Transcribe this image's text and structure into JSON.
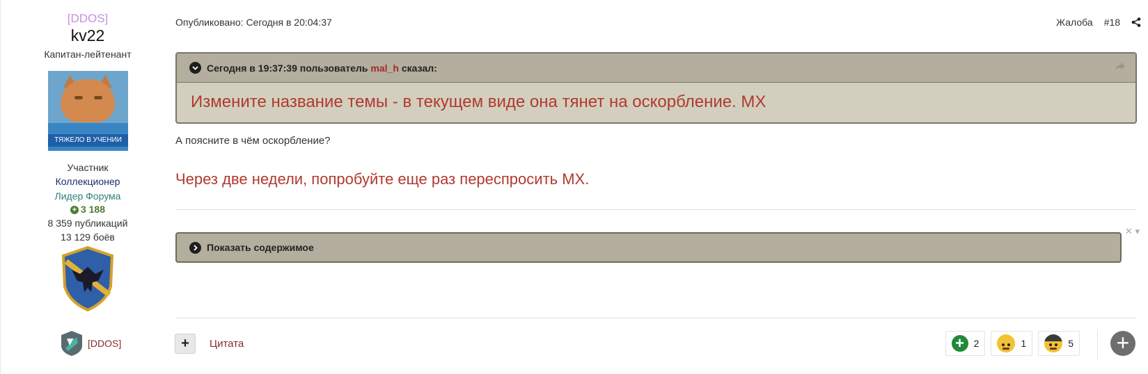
{
  "author": {
    "clan_tag": "[DDOS]",
    "username": "kv22",
    "rank": "Капитан-лейтенант",
    "avatar_caption": "ТЯЖЕЛО В УЧЕНИИ",
    "roles": [
      "Участник",
      "Коллекционер",
      "Лидер Форума"
    ],
    "reputation": "3 188",
    "posts": "8 359 публикаций",
    "battles": "13 129 боёв",
    "clan_row_label": "[DDOS]"
  },
  "post": {
    "published": "Опубликовано: Сегодня в 20:04:37",
    "report_label": "Жалоба",
    "post_number": "#18",
    "quote": {
      "prefix": "Сегодня в 19:37:39 пользователь",
      "user": "mal_h",
      "suffix": "сказал:",
      "text": "Измените название темы - в текущем виде она тянет на оскорбление. МХ"
    },
    "text": "А поясните в чём оскорбление?",
    "moderator_note": "Через две недели, попробуйте еще раз переспросить МХ.",
    "spoiler_label": "Показать содержимое"
  },
  "footer": {
    "multiquote_symbol": "+",
    "quote_label": "Цитата",
    "reactions": [
      {
        "icon": "plus-icon",
        "count": "2"
      },
      {
        "icon": "smiley-icon",
        "count": "1"
      },
      {
        "icon": "smiley-cap-icon",
        "count": "5"
      }
    ],
    "add_reaction_symbol": "+"
  }
}
